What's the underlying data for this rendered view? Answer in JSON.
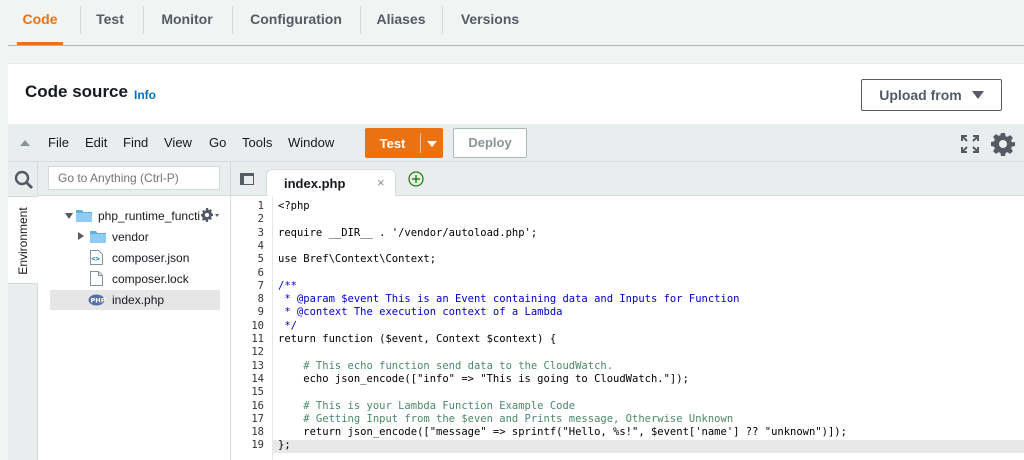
{
  "tabs": [
    {
      "label": "Code",
      "active": true
    },
    {
      "label": "Test"
    },
    {
      "label": "Monitor"
    },
    {
      "label": "Configuration"
    },
    {
      "label": "Aliases"
    },
    {
      "label": "Versions"
    }
  ],
  "code_source": {
    "title": "Code source",
    "info": "Info",
    "upload_label": "Upload from"
  },
  "ide": {
    "menu": [
      "File",
      "Edit",
      "Find",
      "View",
      "Go",
      "Tools",
      "Window"
    ],
    "test_label": "Test",
    "deploy_label": "Deploy",
    "search_placeholder": "Go to Anything (Ctrl-P)",
    "environment_tab": "Environment",
    "tree": [
      {
        "label": "php_runtime_functi",
        "type": "folder-open"
      },
      {
        "label": "vendor",
        "type": "folder"
      },
      {
        "label": "composer.json",
        "type": "json"
      },
      {
        "label": "composer.lock",
        "type": "file"
      },
      {
        "label": "index.php",
        "type": "php"
      }
    ],
    "open_tab": "index.php",
    "close_glyph": "×",
    "line_numbers": [
      "1",
      "2",
      "3",
      "4",
      "5",
      "6",
      "7",
      "8",
      "9",
      "10",
      "11",
      "12",
      "13",
      "14",
      "15",
      "16",
      "17",
      "18",
      "19"
    ],
    "code": [
      "<?php",
      "",
      "require __DIR__ . '/vendor/autoload.php';",
      "",
      "use Bref\\Context\\Context;",
      "",
      "/**",
      " * @param $event This is an Event containing data and Inputs for Function",
      " * @context The execution context of a Lambda",
      " */",
      "return function ($event, Context $context) {",
      "",
      "    # This echo function send data to the CloudWatch.",
      "    echo json_encode([\"info\" => \"This is going to CloudWatch.\"]);",
      "",
      "    # This is your Lambda Function Example Code",
      "    # Getting Input from the $even and Prints message, Otherwise Unknown",
      "    return json_encode([\"message\" => sprintf(\"Hello, %s!\", $event['name'] ?? \"unknown\")]);",
      "};"
    ]
  },
  "colors": {
    "accent": "#ec7211",
    "link": "#0073bb",
    "add_tab": "#1d8102"
  }
}
